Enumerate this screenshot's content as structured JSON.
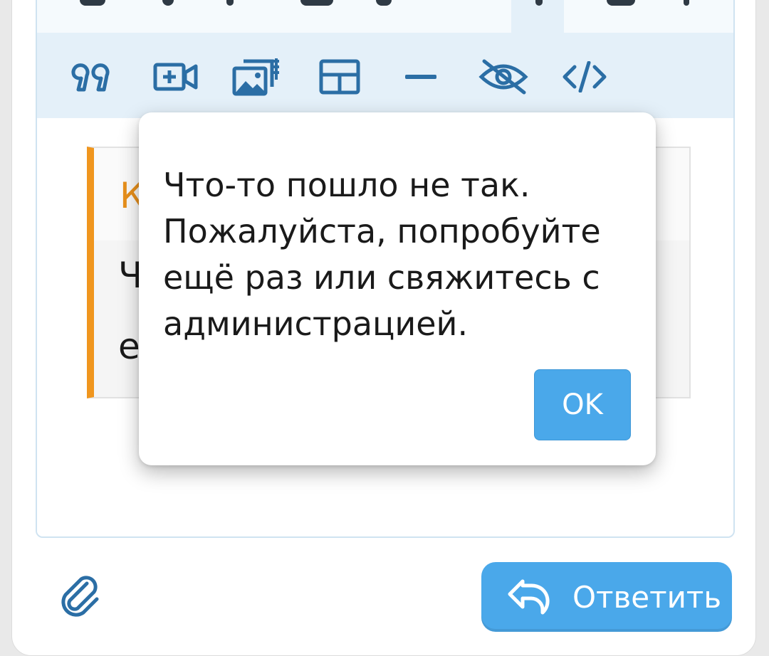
{
  "toolbar": {
    "row2": [
      {
        "icon": "quote-icon"
      },
      {
        "icon": "insert-video-icon"
      },
      {
        "icon": "gallery-icon"
      },
      {
        "icon": "table-icon"
      },
      {
        "icon": "horizontal-rule-icon"
      },
      {
        "icon": "spoiler-hidden-icon"
      },
      {
        "icon": "code-icon"
      }
    ]
  },
  "editor": {
    "quote_title_fragment": "К",
    "quote_line1_fragment": "Ч",
    "quote_line2_fragment": "е"
  },
  "dialog": {
    "message": "Что-то пошло не так. Пожалуйста, попробуйте ещё раз или свяжитесь с администрацией.",
    "ok_label": "OK"
  },
  "footer": {
    "attach_icon": "paperclip-icon",
    "reply_label": "Ответить",
    "reply_icon": "reply-arrow-icon"
  },
  "colors": {
    "accent": "#4aa8ea",
    "toolbar_bg": "#e4f0f9",
    "quote_bar": "#f0961e",
    "icon": "#2b6ea5"
  }
}
